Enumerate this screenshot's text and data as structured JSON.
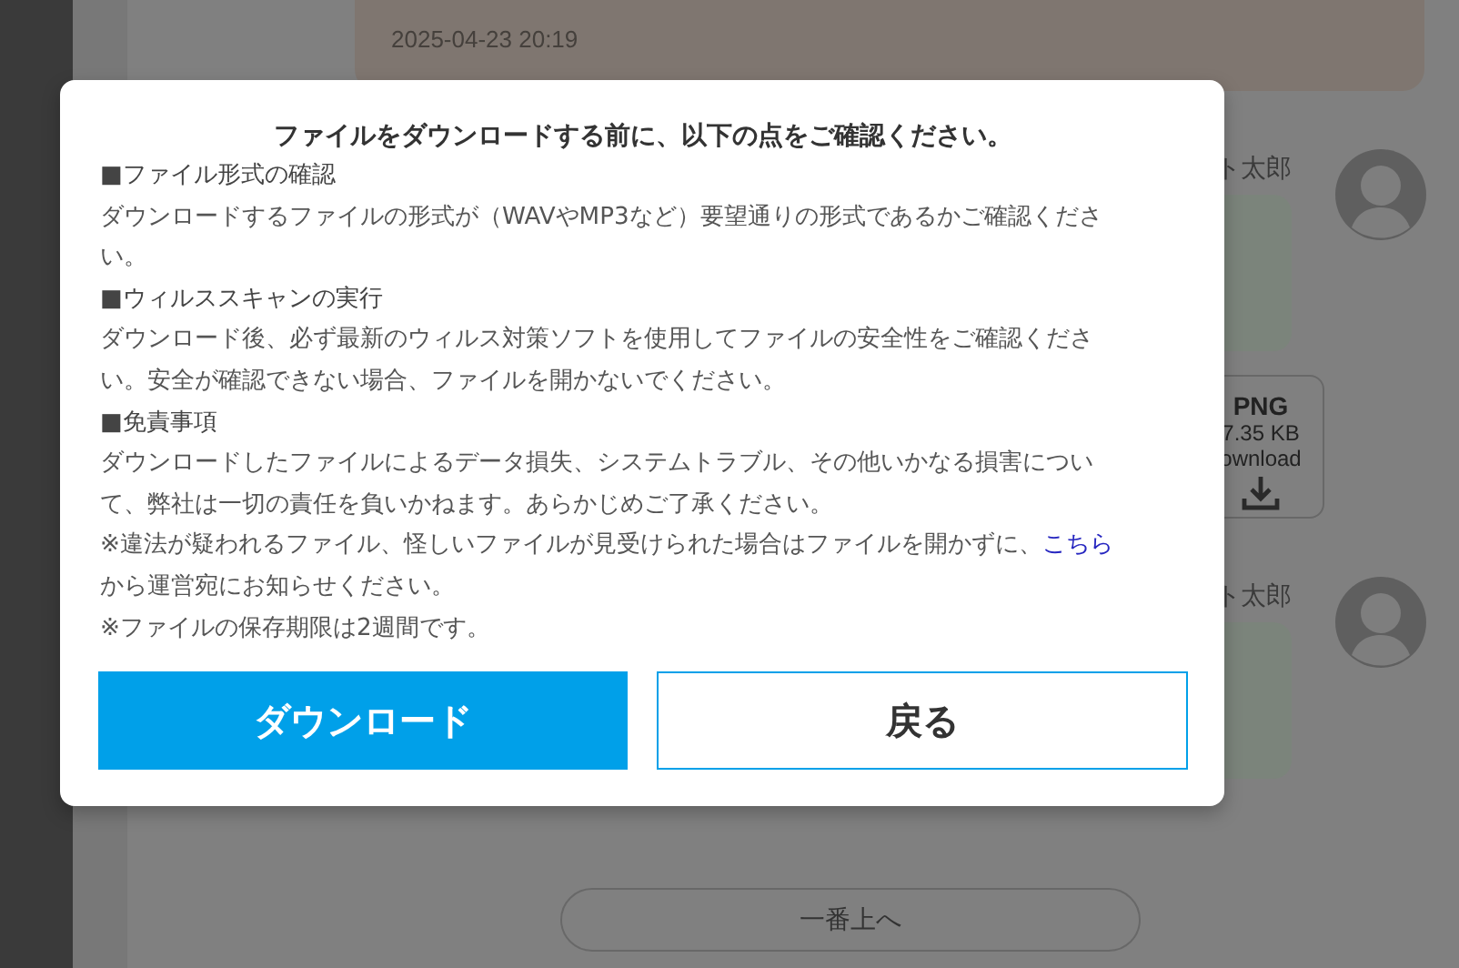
{
  "background": {
    "message": {
      "time": "2025-04-23 20:19"
    },
    "posts": [
      {
        "author": "ト太郎",
        "file": {
          "type": "PNG",
          "size": "7.35 KB",
          "action": "ownload"
        }
      },
      {
        "author": "ト太郎"
      }
    ],
    "top_button": "一番上へ"
  },
  "dialog": {
    "title": "ファイルをダウンロードする前に、以下の点をご確認ください。",
    "sections": [
      {
        "heading": "■ファイル形式の確認",
        "body": "ダウンロードするファイルの形式が（WAVやMP3など）要望通りの形式であるかご確認ください。"
      },
      {
        "heading": "■ウィルススキャンの実行",
        "body": "ダウンロード後、必ず最新のウィルス対策ソフトを使用してファイルの安全性をご確認ください。安全が確認できない場合、ファイルを開かないでください。"
      },
      {
        "heading": "■免責事項",
        "body": "ダウンロードしたファイルによるデータ損失、システムトラブル、その他いかなる損害について、弊社は一切の責任を負いかねます。あらかじめご了承ください。"
      }
    ],
    "notes": [
      {
        "text": "※違法が疑われるファイル、怪しいファイルが見受けられた場合はファイルを開かずに、",
        "link": "こちら",
        "after": "から運営宛にお知らせください。"
      },
      {
        "text": "※ファイルの保存期限は2週間です。"
      }
    ],
    "buttons": [
      {
        "label": "ダウンロード",
        "kind": "primary"
      },
      {
        "label": "戻る",
        "kind": "secondary"
      }
    ]
  }
}
